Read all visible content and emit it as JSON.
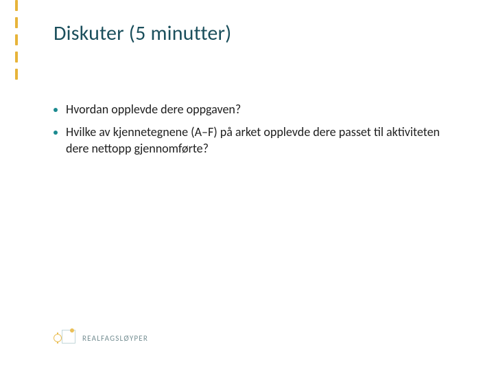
{
  "title": "Diskuter (5 minutter)",
  "bullets": [
    "Hvordan opplevde dere oppgaven?",
    "Hvilke av kjennetegnene (A–F) på arket opplevde dere passet til aktiviteten dere nettopp gjennomførte?"
  ],
  "logo": {
    "text": "REALFAGSLØYPER"
  },
  "colors": {
    "accent_teal": "#1b8a8f",
    "accent_yellow": "#e7b43a",
    "title_color": "#1b4f5c"
  }
}
